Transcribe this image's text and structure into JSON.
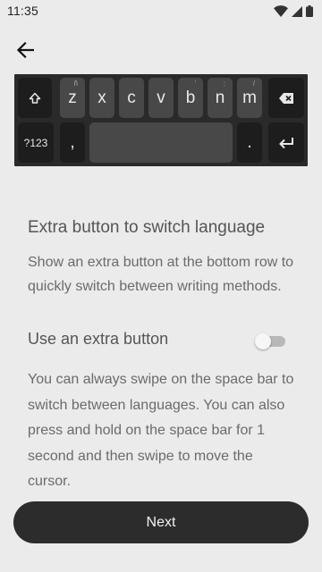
{
  "status_bar": {
    "time": "11:35",
    "icons": [
      "wifi-icon",
      "cell-signal-icon",
      "battery-icon"
    ]
  },
  "header": {
    "back_icon": "arrow-left-icon"
  },
  "keyboard_preview": {
    "row1": [
      {
        "label": "",
        "icon": "shift-icon",
        "type": "func"
      },
      {
        "label": "z",
        "hint": "ñ",
        "type": "letter"
      },
      {
        "label": "x",
        "hint": "",
        "type": "letter"
      },
      {
        "label": "c",
        "hint": "",
        "type": "letter"
      },
      {
        "label": "v",
        "hint": "",
        "type": "letter"
      },
      {
        "label": "b",
        "hint": "'",
        "type": "letter"
      },
      {
        "label": "n",
        "hint": ":",
        "type": "letter"
      },
      {
        "label": "m",
        "hint": "/",
        "type": "letter"
      },
      {
        "label": "",
        "icon": "backspace-icon",
        "type": "func"
      }
    ],
    "row2": [
      {
        "label": "?123",
        "type": "func"
      },
      {
        "label": ",",
        "type": "func"
      },
      {
        "label": "",
        "type": "space"
      },
      {
        "label": ".",
        "type": "func"
      },
      {
        "label": "",
        "icon": "enter-icon",
        "type": "func"
      }
    ]
  },
  "content": {
    "title": "Extra button to switch language",
    "description": "Show an extra button at the bottom row to quickly switch between writing methods.",
    "option_label": "Use an extra button",
    "toggle_on": false,
    "info": "You can always swipe on the space bar to switch between languages. You can also press and hold on the space bar for 1 second and then swipe to move the cursor."
  },
  "footer": {
    "next_label": "Next"
  }
}
